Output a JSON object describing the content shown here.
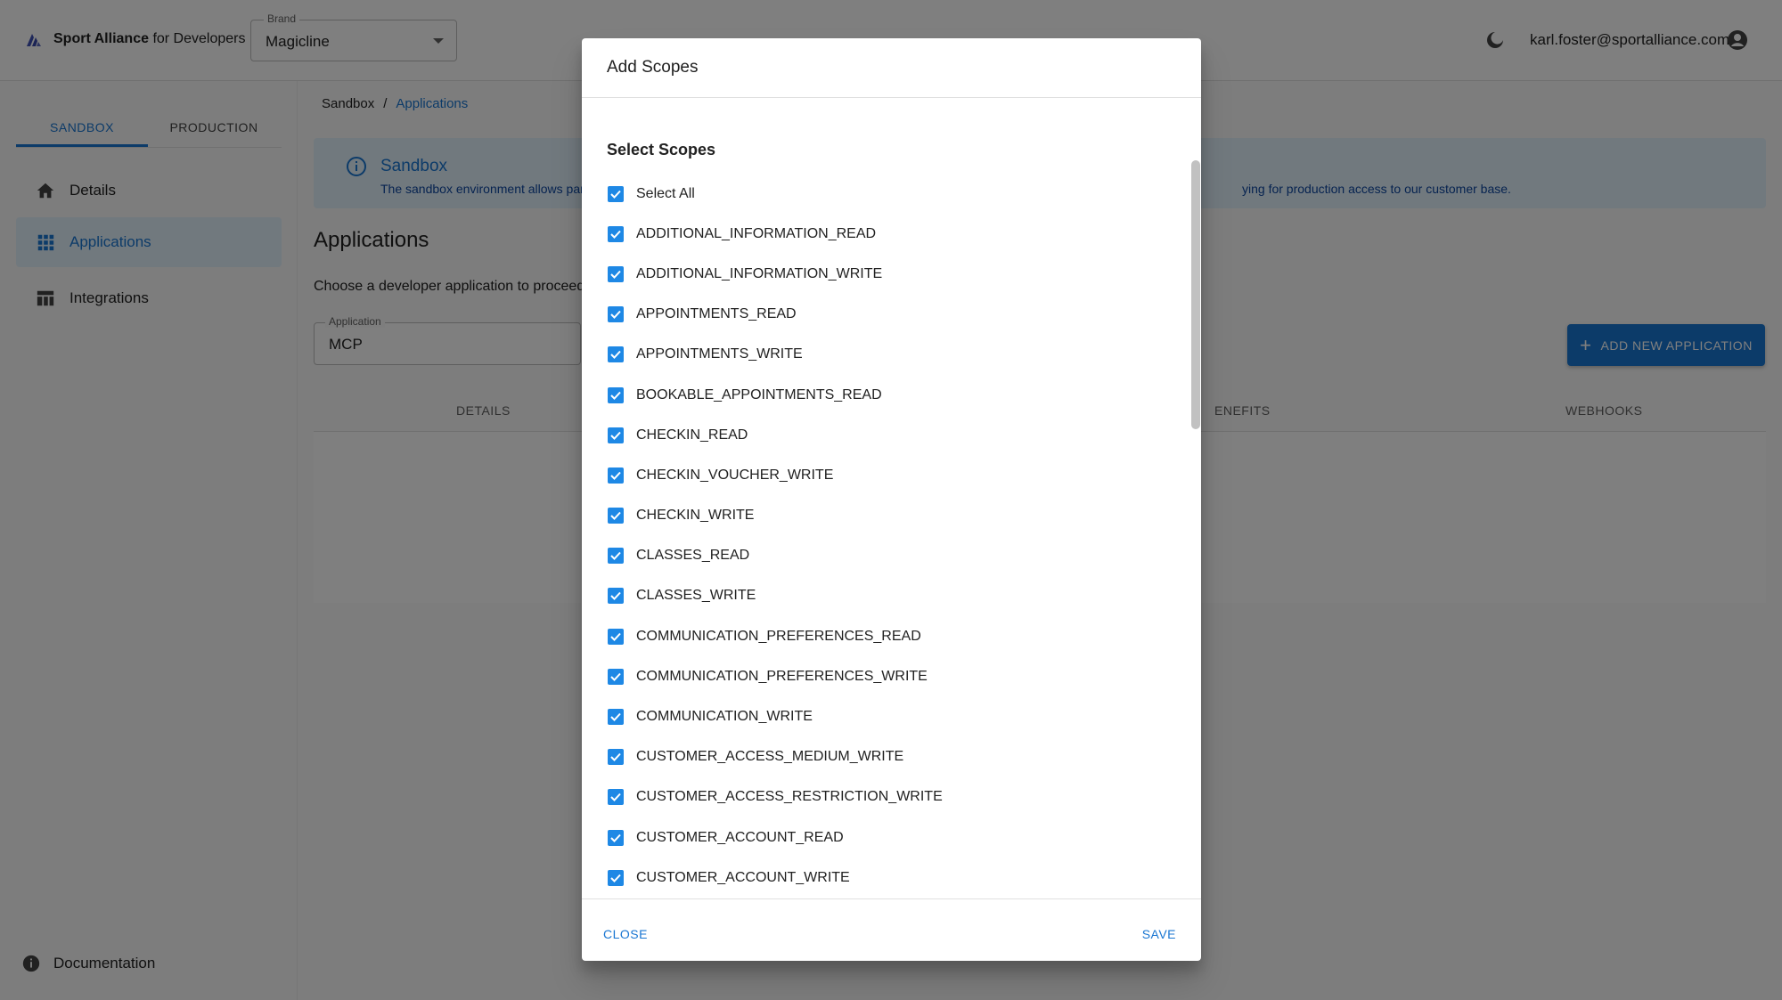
{
  "header": {
    "logo_bold": "Sport Alliance",
    "logo_rest": "for Developers",
    "brand_label": "Brand",
    "brand_value": "Magicline",
    "user_email": "karl.foster@sportalliance.com"
  },
  "sidebar": {
    "env_tabs": [
      "SANDBOX",
      "PRODUCTION"
    ],
    "items": [
      {
        "label": "Details",
        "icon": "home-icon"
      },
      {
        "label": "Applications",
        "icon": "grid-icon"
      },
      {
        "label": "Integrations",
        "icon": "table-icon"
      }
    ],
    "documentation": "Documentation"
  },
  "main": {
    "breadcrumb": [
      "Sandbox",
      "/",
      "Applications"
    ],
    "banner": {
      "title": "Sandbox",
      "text": "The sandbox environment allows partn"
    },
    "banner_tail": "ying for production access to our customer base.",
    "page_title": "Applications",
    "page_hint": "Choose a developer application to proceed",
    "app_select": {
      "label": "Application",
      "value": "MCP"
    },
    "add_button": "ADD NEW APPLICATION",
    "tabs": [
      "DETAILS",
      "ENEFITS",
      "WEBHOOKS"
    ]
  },
  "modal": {
    "title": "Add Scopes",
    "section_title": "Select Scopes",
    "scopes": [
      "Select All",
      "ADDITIONAL_INFORMATION_READ",
      "ADDITIONAL_INFORMATION_WRITE",
      "APPOINTMENTS_READ",
      "APPOINTMENTS_WRITE",
      "BOOKABLE_APPOINTMENTS_READ",
      "CHECKIN_READ",
      "CHECKIN_VOUCHER_WRITE",
      "CHECKIN_WRITE",
      "CLASSES_READ",
      "CLASSES_WRITE",
      "COMMUNICATION_PREFERENCES_READ",
      "COMMUNICATION_PREFERENCES_WRITE",
      "COMMUNICATION_WRITE",
      "CUSTOMER_ACCESS_MEDIUM_WRITE",
      "CUSTOMER_ACCESS_RESTRICTION_WRITE",
      "CUSTOMER_ACCOUNT_READ",
      "CUSTOMER_ACCOUNT_WRITE"
    ],
    "close_label": "CLOSE",
    "save_label": "SAVE"
  },
  "colors": {
    "accent": "#1976d2",
    "checkbox": "#1e88e5",
    "banner_bg": "#e3f2fd"
  }
}
